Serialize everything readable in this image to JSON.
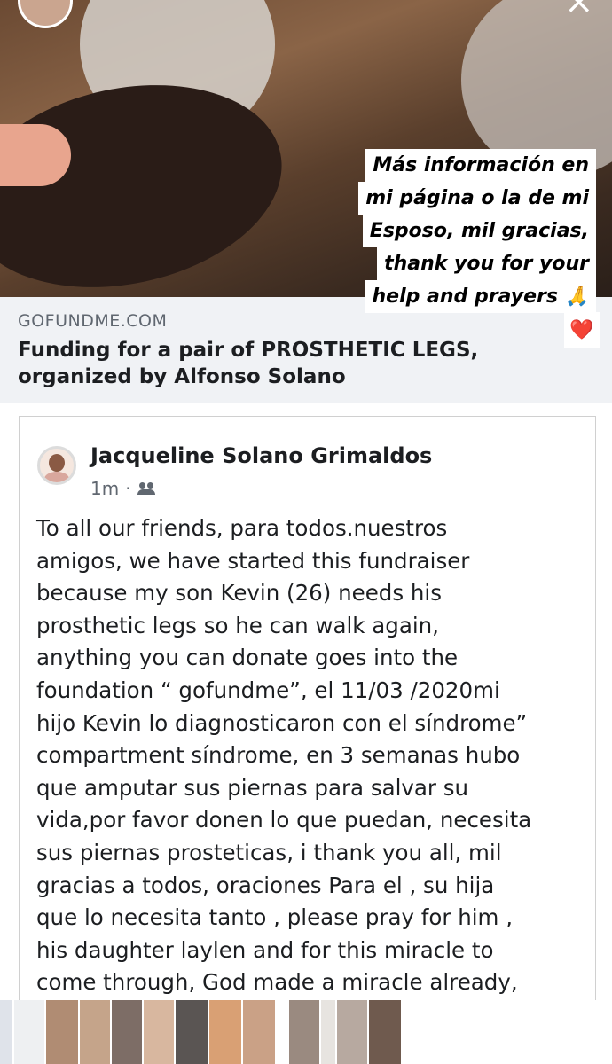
{
  "story": {
    "overlay_lines": [
      "Más información en",
      "mi página o la de mi",
      "Esposo, mil gracias,",
      "thank you for your",
      "help and prayers 🙏"
    ],
    "heart": "❤️"
  },
  "link_card": {
    "domain": "GOFUNDME.COM",
    "title": "Funding for a pair of PROSTHETIC LEGS, organized by Alfonso Solano"
  },
  "post": {
    "author": "Jacqueline Solano Grimaldos",
    "time": "1m",
    "separator": "·",
    "audience_icon": "friends-icon",
    "body": "To all our friends, para todos.nuestros\namigos, we have started this fundraiser\nbecause my son Kevin (26) needs his\nprosthetic legs so he can walk again,\nanything you can donate goes into the\nfoundation “ gofundme”, el 11/03 /2020mi\nhijo Kevin lo diagnosticaron con el síndrome”\ncompartment síndrome, en 3 semanas hubo\nque amputar sus piernas para salvar su\nvida,por favor donen lo que puedan, necesita\nsus piernas prosteticas, i thank you all, mil\ngracias a todos, oraciones Para el , su hija\nque lo necesita tanto , please pray for him ,\nhis daughter laylen and for this miracle to\ncome through, God made a miracle already,"
  },
  "colors": {
    "link_card_bg": "#f0f2f5",
    "domain_text": "#606770",
    "primary_text": "#1c1e21"
  },
  "thumbnails": [
    {
      "name": "thumb-1",
      "color": "#dfe3ea"
    },
    {
      "name": "thumb-2",
      "color": "#eef0f2"
    },
    {
      "name": "thumb-3",
      "color": "#b08c73"
    },
    {
      "name": "thumb-4",
      "color": "#c5a48a"
    },
    {
      "name": "thumb-5",
      "color": "#7d6d66"
    },
    {
      "name": "thumb-6",
      "color": "#d8b79f"
    },
    {
      "name": "thumb-7",
      "color": "#5a5553"
    },
    {
      "name": "thumb-8",
      "color": "#d9a074"
    },
    {
      "name": "thumb-9",
      "color": "#caa186"
    },
    {
      "name": "thumb-10",
      "color": "#9a8a80"
    },
    {
      "name": "thumb-11",
      "color": "#e7e4e0"
    },
    {
      "name": "thumb-12",
      "color": "#b7a9a0"
    },
    {
      "name": "thumb-13",
      "color": "#6f5a4e"
    }
  ]
}
